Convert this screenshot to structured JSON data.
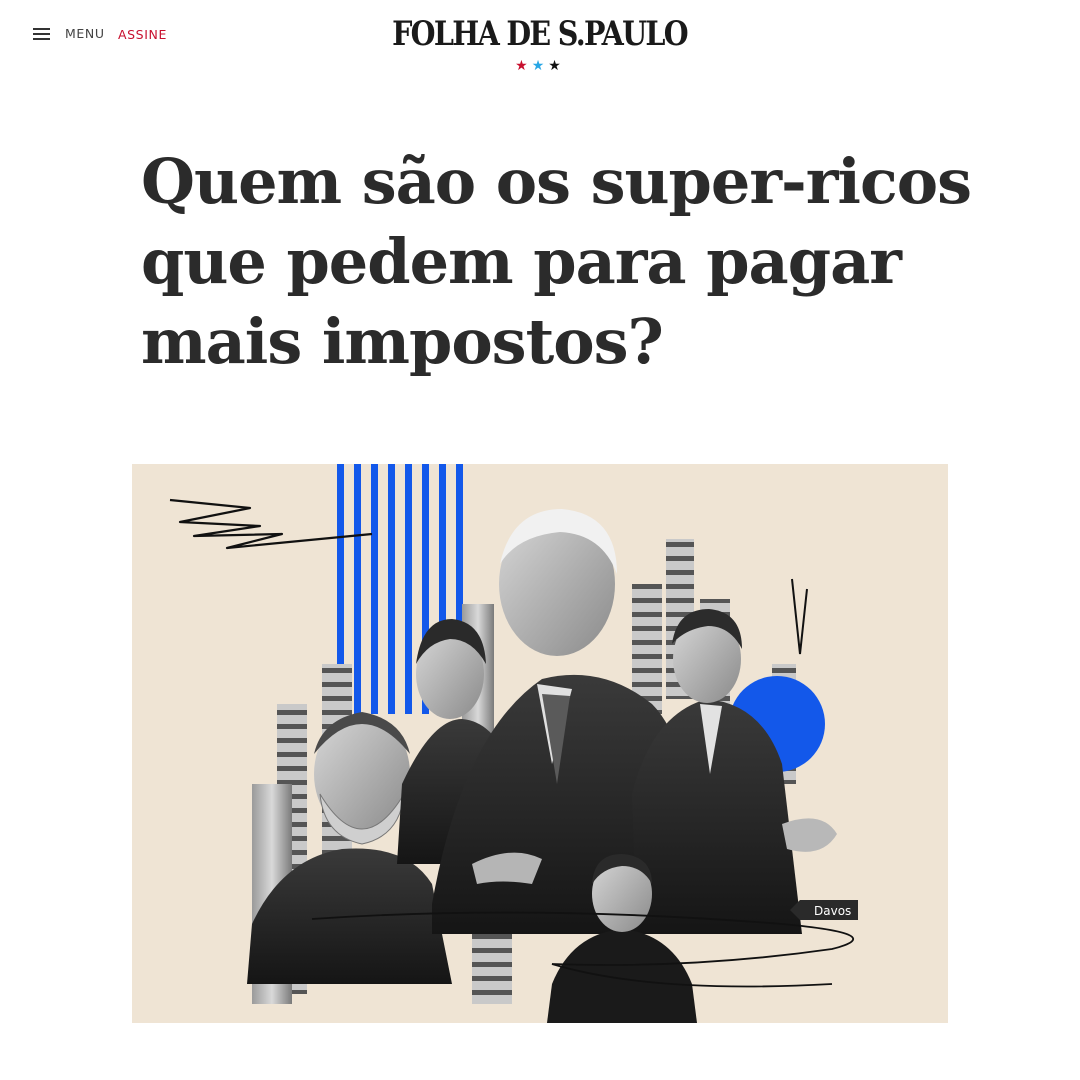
{
  "header": {
    "menu_label": "MENU",
    "subscribe_label": "ASSINE",
    "logo_text": "FOLHA DE S.PAULO",
    "logo_stars": [
      "★",
      "★",
      "★"
    ]
  },
  "article": {
    "headline": "Quem são os super-ricos que pedem para pagar mais impostos?"
  },
  "illustration": {
    "sign_text": "Davos"
  },
  "colors": {
    "brand_red": "#c8102e",
    "star_blue": "#27a6e5",
    "illustration_background": "#efe4d4",
    "illustration_blue": "#1358ea"
  },
  "icons": {
    "menu": "hamburger-icon"
  }
}
